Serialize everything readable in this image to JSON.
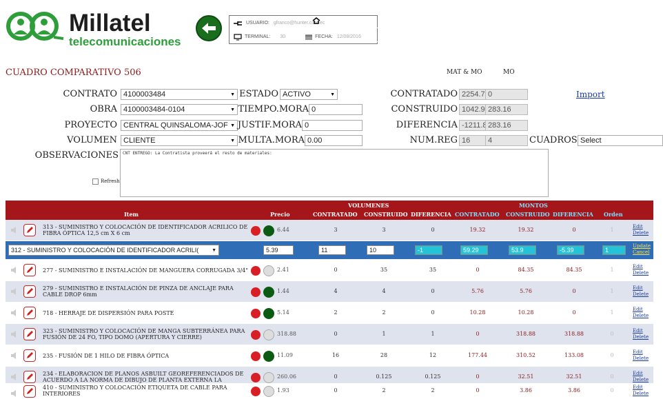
{
  "brand": {
    "name": "Millatel",
    "tagline": "telecomunicaciones"
  },
  "user_box": {
    "usuario_label": "USUARIO:",
    "usuario_value": "gfranco@hunter.com.ec",
    "terminal_label": "TERMINAL:",
    "terminal_value": "30",
    "fecha_label": "FECHA:",
    "fecha_value": "12/08/2016"
  },
  "page_title": "CUADRO COMPARATIVO",
  "page_id": "506",
  "col_headers": {
    "mat_mo": "MAT & MO",
    "mo": "MO"
  },
  "form": {
    "contrato_label": "CONTRATO",
    "contrato_value": "4100003484",
    "obra_label": "OBRA",
    "obra_value": "4100003484-0104",
    "proyecto_label": "PROYECTO",
    "proyecto_value": "CENTRAL QUINSALOMA-JOF",
    "volumen_label": "VOLUMEN",
    "volumen_value": "CLIENTE",
    "estado_label": "ESTADO",
    "estado_value": "ACTIVO",
    "tiempo_mora_label": "TIEMPO.MORA",
    "tiempo_mora_value": "0",
    "justif_mora_label": "JUSTIF.MORA",
    "justif_mora_value": "0",
    "multa_mora_label": "MULTA.MORA",
    "multa_mora_value": "0.00",
    "contratado_label": "CONTRATADO",
    "contratado_mat": "2254.73",
    "contratado_mo": "0",
    "construido_label": "CONSTRUIDO",
    "construido_mat": "1042.9",
    "construido_mo": "283.16",
    "diferencia_label": "DIFERENCIA",
    "diferencia_mat": "-1211.83",
    "diferencia_mo": "283.16",
    "numreg_label": "NUM.REG",
    "numreg_mat": "16",
    "numreg_mo": "4",
    "cuadros_label": "CUADROS",
    "cuadros_value": "Select",
    "observaciones_label": "OBSERVACIONES",
    "observaciones_value": "CNT ENTREGO:  La Contratista proveerá el resto de materiales:",
    "refresh_label": "Refresh",
    "import_label": "Import"
  },
  "table": {
    "group_volumenes": "VOLUMENES",
    "group_montos": "MONTOS",
    "headers": {
      "item": "Item",
      "precio": "Precio",
      "v_contratado": "CONTRATADO",
      "v_construido": "CONSTRUIDO",
      "v_diferencia": "DIFERENCIA",
      "m_contratado": "CONTRATADO",
      "m_construido": "CONSTRUIDO",
      "m_diferencia": "DIFERENCIA",
      "orden": "Orden"
    },
    "edit_label": "Edit",
    "delete_label": "Delete",
    "update_label": "Update",
    "cancel_label": "Cancel",
    "editing_row": {
      "item": "312 - SUMINISTRO Y COLOCACIÓN DE IDENTIFICADOR ACRILI(",
      "precio": "5.39",
      "v_contratado": "11",
      "v_construido": "10",
      "v_diferencia": "-1",
      "m_contratado": "59.29",
      "m_construido": "53.9",
      "m_diferencia": "-5.39",
      "orden": "1"
    },
    "rows": [
      {
        "item": "313 - SUMINISTRO Y COLOCACIÓN DE IDENTIFICADOR ACRILICO DE FIBRA ÓPTICA 12,5 cm X 6 cm",
        "precio": "6.44",
        "status": "on",
        "v_contratado": "3",
        "v_construido": "3",
        "v_diferencia": "0",
        "m_contratado": "19.32",
        "m_construido": "19.32",
        "m_diferencia": "0",
        "orden": "1"
      },
      {
        "item": "277 - SUMINISTRO E INSTALACIÓN DE MANGUERA CORRUGADA 3/4\"",
        "precio": "2.41",
        "status": "off",
        "v_contratado": "0",
        "v_construido": "35",
        "v_diferencia": "35",
        "m_contratado": "0",
        "m_construido": "84.35",
        "m_diferencia": "84.35",
        "orden": "1"
      },
      {
        "item": "279 - SUMINISTRO E INSTALACIÓN DE PINZA DE ANCLAJE PARA CABLE DROP 6mm",
        "precio": "1.44",
        "status": "on",
        "v_contratado": "4",
        "v_construido": "4",
        "v_diferencia": "0",
        "m_contratado": "5.76",
        "m_construido": "5.76",
        "m_diferencia": "0",
        "orden": "1"
      },
      {
        "item": "718 - HERRAJE DE DISPERSIÓN PARA POSTE",
        "precio": "5.14",
        "status": "on",
        "v_contratado": "2",
        "v_construido": "2",
        "v_diferencia": "0",
        "m_contratado": "10.28",
        "m_construido": "10.28",
        "m_diferencia": "0",
        "orden": "1"
      },
      {
        "item": "323 - SUMINISTRO Y COLOCACIÓN DE MANGA SUBTERRÁNEA PARA FUSIÓN DE 24 FO, TIPO DOMO (APERTURA Y CIERRE)",
        "precio": "318.88",
        "status": "off",
        "v_contratado": "0",
        "v_construido": "1",
        "v_diferencia": "1",
        "m_contratado": "0",
        "m_construido": "318.88",
        "m_diferencia": "318.88",
        "orden": "0"
      },
      {
        "item": "235 - FUSIÓN DE 1 HILO DE FIBRA ÓPTICA",
        "precio": "11.09",
        "status": "on",
        "v_contratado": "16",
        "v_construido": "28",
        "v_diferencia": "12",
        "m_contratado": "177.44",
        "m_construido": "310.52",
        "m_diferencia": "133.08",
        "orden": "0"
      },
      {
        "item": "234 - ELABORACION DE PLANOS ASBUILT GEOREFERENCIADOS DE ACUERDO A LA NORMA DE DIBUJO DE PLANTA EXTERNA LA",
        "precio": "260.06",
        "status": "off",
        "v_contratado": "0",
        "v_construido": "0.125",
        "v_diferencia": "0.125",
        "m_contratado": "0",
        "m_construido": "32.51",
        "m_diferencia": "32.51",
        "orden": "0"
      },
      {
        "item": "410 - SUMINISTRO Y COLOCACIÓN ETIQUETA DE CABLE PARA INTERIORES",
        "precio": "1.93",
        "status": "off",
        "v_contratado": "0",
        "v_construido": "2",
        "v_diferencia": "2",
        "m_contratado": "0",
        "m_construido": "3.86",
        "m_diferencia": "3.86",
        "orden": "0"
      }
    ]
  },
  "colors": {
    "brand_green": "#2e9e3a",
    "table_header": "#a5161b",
    "edit_row": "#2f6eb6",
    "title_red": "#8b1a1a"
  },
  "icons": [
    "back-arrow-icon",
    "plug-icon",
    "monitor-icon",
    "calendar-icon",
    "speaker-icon",
    "pencil-icon",
    "gear-icon",
    "status-dot-icon"
  ]
}
